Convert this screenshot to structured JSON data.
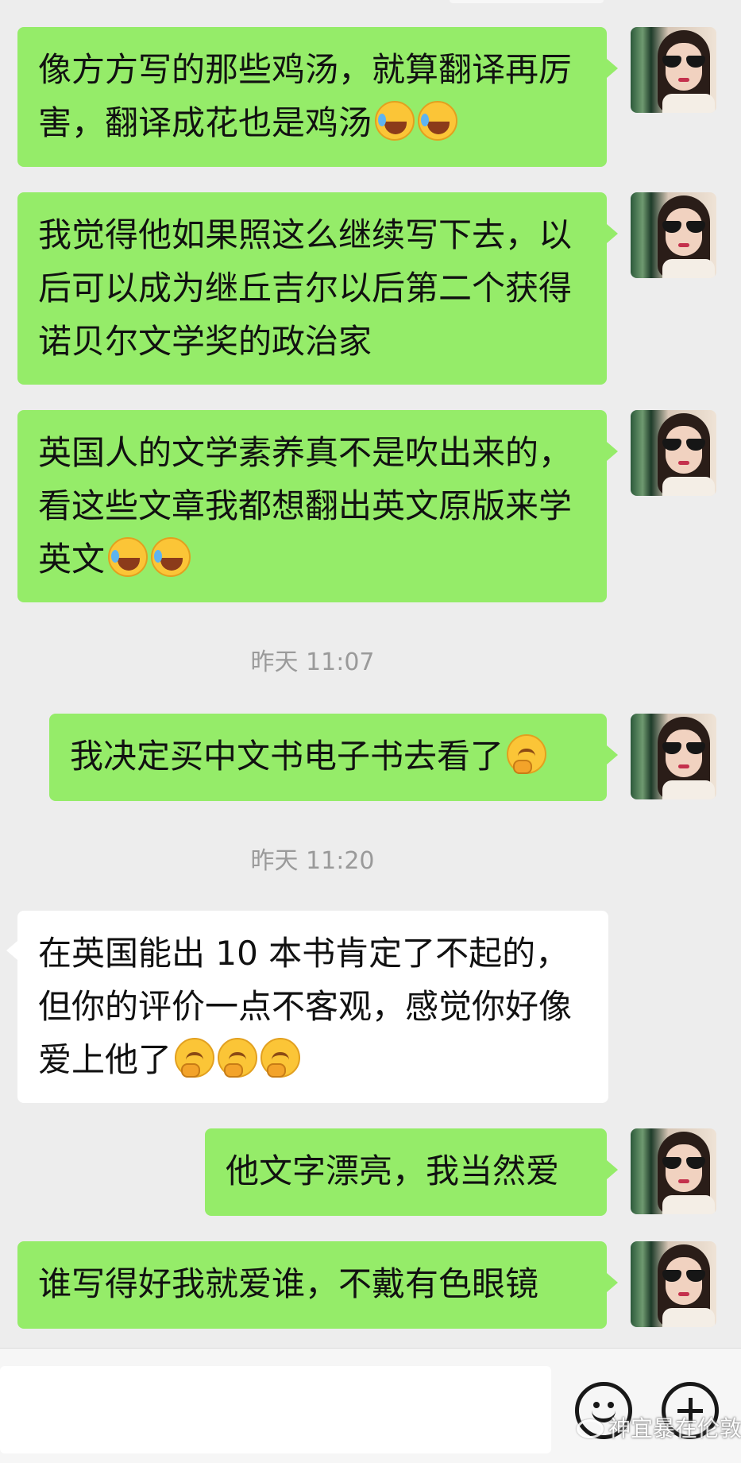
{
  "messages": [
    {
      "sender": "me",
      "text": "像方方写的那些鸡汤，就算翻译再厉害，翻译成花也是鸡汤",
      "emojis": [
        "laugh-cry-emoji",
        "laugh-cry-emoji"
      ]
    },
    {
      "sender": "me",
      "text": "我觉得他如果照这么继续写下去，以后可以成为继丘吉尔以后第二个获得诺贝尔文学奖的政治家",
      "emojis": []
    },
    {
      "sender": "me",
      "text": "英国人的文学素养真不是吹出来的，看这些文章我都想翻出英文原版来学英文",
      "emojis": [
        "laugh-cry-emoji",
        "laugh-cry-emoji"
      ]
    },
    {
      "sender": "system",
      "text": "昨天 11:07"
    },
    {
      "sender": "me",
      "text": "我决定买中文书电子书去看了",
      "emojis": [
        "thinking-emoji"
      ]
    },
    {
      "sender": "system",
      "text": "昨天 11:20"
    },
    {
      "sender": "other",
      "text": "在英国能出 10 本书肯定了不起的，但你的评价一点不客观，感觉你好像爱上他了",
      "emojis": [
        "thinking-emoji",
        "thinking-emoji",
        "thinking-emoji"
      ]
    },
    {
      "sender": "me",
      "text": "他文字漂亮，我当然爱",
      "emojis": []
    },
    {
      "sender": "me",
      "text": "谁写得好我就爱谁，不戴有色眼镜",
      "emojis": []
    }
  ],
  "input_bar": {
    "placeholder": "",
    "emoji_button_icon": "smile-icon",
    "more_button_icon": "plus-icon"
  },
  "watermark": "神宜暴在伦敦",
  "colors": {
    "background": "#ededed",
    "my_bubble": "#95ec69",
    "other_bubble": "#ffffff",
    "timestamp": "#9a9a9a"
  }
}
